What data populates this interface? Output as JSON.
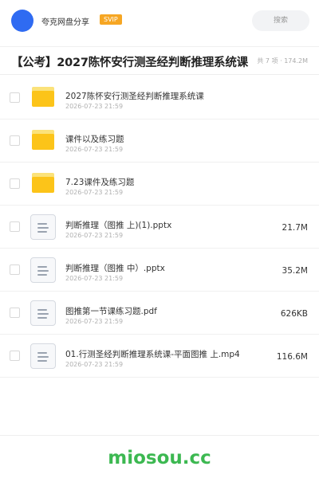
{
  "header": {
    "user_name": "夸克网盘分享",
    "badge": "SVIP",
    "search_label": "搜索"
  },
  "folder": {
    "title": "【公考】2027陈怀安行测圣经判断推理系统课",
    "meta": "共 7 项 · 174.2M"
  },
  "files": [
    {
      "type": "folder",
      "name": "2027陈怀安行测圣经判断推理系统课",
      "date": "2026-07-23 21:59",
      "size": ""
    },
    {
      "type": "folder",
      "name": "课件以及练习题",
      "date": "2026-07-23 21:59",
      "size": ""
    },
    {
      "type": "folder",
      "name": "7.23课件及练习题",
      "date": "2026-07-23 21:59",
      "size": ""
    },
    {
      "type": "file",
      "name": "判断推理（图推 上)(1).pptx",
      "date": "2026-07-23 21:59",
      "size": "21.7M"
    },
    {
      "type": "file",
      "name": "判断推理（图推 中）.pptx",
      "date": "2026-07-23 21:59",
      "size": "35.2M"
    },
    {
      "type": "file",
      "name": "图推第一节课练习题.pdf",
      "date": "2026-07-23 21:59",
      "size": "626KB"
    },
    {
      "type": "file",
      "name": "01.行测圣经判断推理系统课-平面图推 上.mp4",
      "date": "2026-07-23 21:59",
      "size": "116.6M"
    }
  ],
  "watermark": "miosou.cc",
  "colors": {
    "avatar": "#2f6bf2",
    "svip": "#f6a623",
    "folder": "#fcc419",
    "watermark": "#3cb851"
  }
}
